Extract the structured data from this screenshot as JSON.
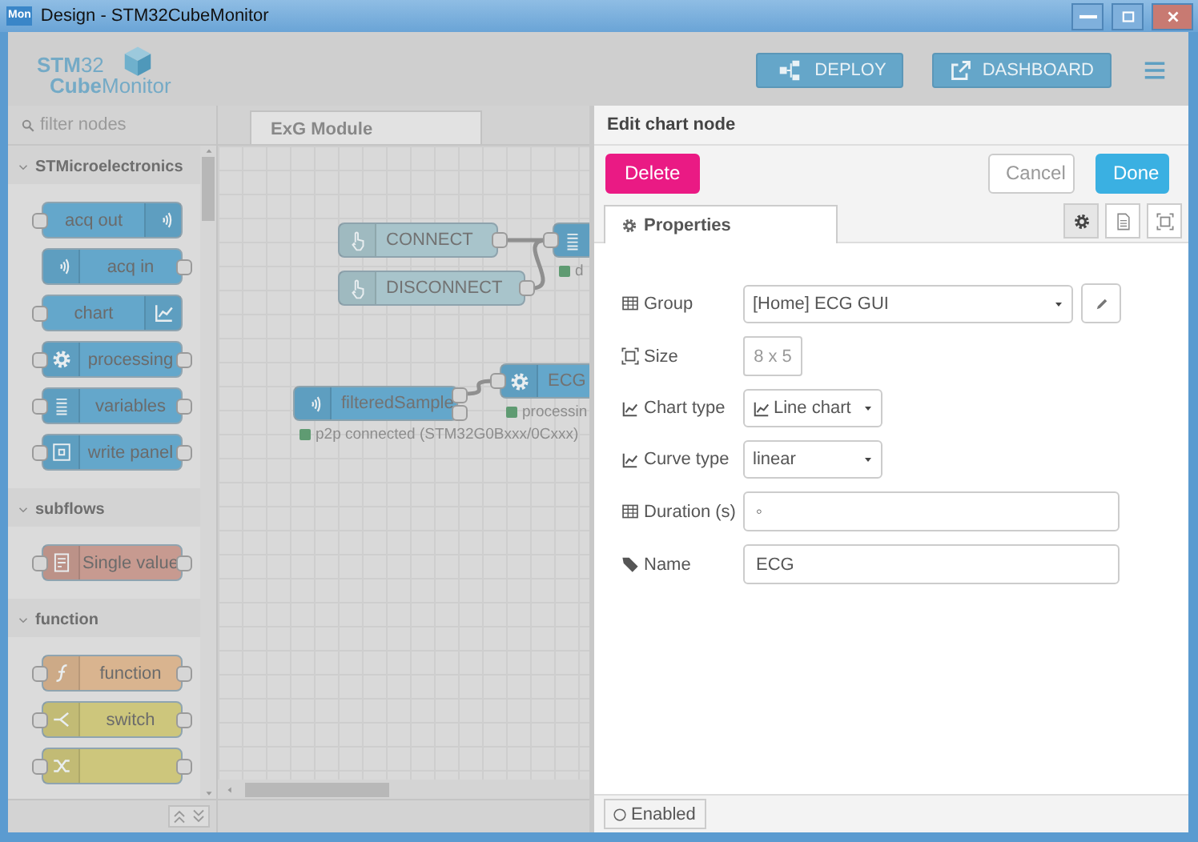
{
  "window": {
    "app_icon": "Mon",
    "title": "Design - STM32CubeMonitor"
  },
  "header": {
    "logo": {
      "line_1": "**STM**32",
      "line_2": "**Cube**Monitor"
    },
    "buttons": [
      {
        "label": "DEPLOY"
      },
      {
        "label": "DASHBOARD"
      }
    ]
  },
  "palette": {
    "filter": {
      "placeholder": "filter nodes"
    },
    "categories": [
      {
        "name": "STMicroelectronics",
        "expanded": true,
        "nodes": [
          {
            "label": "acq out",
            "kind": "sender",
            "color": "#64a7cb"
          },
          {
            "label": "acq in",
            "kind": "receiver",
            "color": "#64a7cb"
          },
          {
            "label": "chart",
            "kind": "chart",
            "color": "#64a7cb"
          },
          {
            "label": "processing",
            "kind": "processing",
            "color": "#64a7cb"
          },
          {
            "label": "variables",
            "kind": "variables",
            "color": "#64a7cb"
          },
          {
            "label": "write panel",
            "kind": "panel",
            "color": "#64a7cb"
          }
        ]
      },
      {
        "name": "subflows",
        "expanded": true,
        "nodes": [
          {
            "label": "Single value",
            "kind": "subflow",
            "color": "#c79a90"
          }
        ]
      },
      {
        "name": "function",
        "expanded": true,
        "nodes": [
          {
            "label": "function",
            "kind": "function",
            "color": "#d9b48f"
          },
          {
            "label": "switch",
            "kind": "switch",
            "color": "#cdc67c"
          },
          {
            "kind": "change",
            "color": "#cdc67c"
          }
        ]
      }
    ]
  },
  "workspace": {
    "tabs": [
      {
        "label": "ExG Module",
        "selected": true
      }
    ],
    "nodes": [
      {
        "label": "CONNECT",
        "kind": "button",
        "color": "#a8c4cb"
      },
      {
        "kind": "variables",
        "color": "#64a7cb",
        "status": {
          "text": "d",
          "color": "#5f9b72"
        }
      },
      {
        "label": "DISCONNECT",
        "kind": "button",
        "color": "#a8c4cb"
      },
      {
        "label": "ECG",
        "kind": "processing",
        "color": "#64a7cb",
        "status": {
          "text": "processin",
          "color": "#5f9b72"
        }
      },
      {
        "label": "filteredSample",
        "kind": "dualreceiver",
        "color": "#64a7cb",
        "status": {
          "text": "p2p connected (STM32G0Bxxx/0Cxxx)",
          "color": "#5f9b72"
        }
      }
    ]
  },
  "editor": {
    "title": "Edit chart node",
    "actions": [
      {
        "label": "Delete",
        "kind": "danger"
      },
      {
        "label": "Cancel",
        "kind": "plain"
      },
      {
        "label": "Done",
        "kind": "primary"
      }
    ],
    "tabs": [
      {
        "label": "Properties",
        "selected": true
      }
    ],
    "tab_icons": [
      {
        "selected": true
      },
      {
        "selected": false
      },
      {
        "selected": false
      }
    ],
    "fields": [
      {
        "label": "Group",
        "kind": "select",
        "value": "[Home] ECG GUI",
        "edit_button": true
      },
      {
        "label": "Size",
        "kind": "size",
        "value": "8 x 5"
      },
      {
        "label": "Chart type",
        "kind": "chartselect",
        "value": "Line chart"
      },
      {
        "label": "Curve type",
        "kind": "select",
        "value": "linear"
      },
      {
        "label": "Duration (s)",
        "kind": "input",
        "value": "◦"
      },
      {
        "label": "Name",
        "kind": "input",
        "value": "ECG"
      }
    ],
    "footer": {
      "label": "Enabled",
      "enabled": false
    }
  }
}
